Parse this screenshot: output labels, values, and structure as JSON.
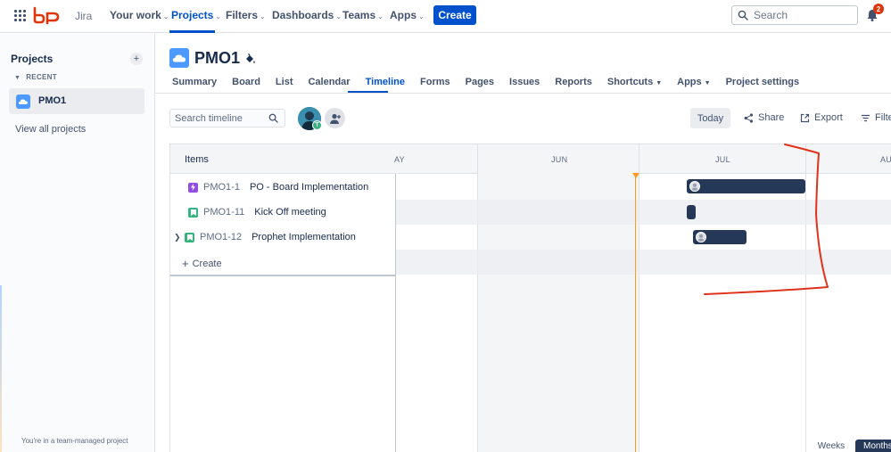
{
  "topnav": {
    "product": "Jira",
    "items": [
      {
        "label": "Your work",
        "chevron": true
      },
      {
        "label": "Projects",
        "chevron": true,
        "active": true
      },
      {
        "label": "Filters",
        "chevron": true
      },
      {
        "label": "Dashboards",
        "chevron": true
      },
      {
        "label": "Teams",
        "chevron": true
      },
      {
        "label": "Apps",
        "chevron": true
      }
    ],
    "create_label": "Create",
    "search_placeholder": "Search",
    "notification_count": "2",
    "icons": {
      "apps": "grid-icon",
      "search": "search-icon",
      "notifications": "bell-icon"
    },
    "accent": "#0052cc"
  },
  "sidebar": {
    "title": "Projects",
    "recent_label": "RECENT",
    "recent_item": "PMO1",
    "view_all": "View all projects",
    "footer": "You're in a team-managed project"
  },
  "project": {
    "name": "PMO1",
    "tabs": [
      {
        "label": "Summary"
      },
      {
        "label": "Board"
      },
      {
        "label": "List"
      },
      {
        "label": "Calendar"
      },
      {
        "label": "Timeline",
        "active": true
      },
      {
        "label": "Forms"
      },
      {
        "label": "Pages"
      },
      {
        "label": "Issues"
      },
      {
        "label": "Reports"
      },
      {
        "label": "Shortcuts",
        "chevron": true
      },
      {
        "label": "Apps",
        "chevron": true
      },
      {
        "label": "Project settings"
      }
    ]
  },
  "toolbar": {
    "search_placeholder": "Search timeline",
    "avatar_badge": "T",
    "today_label": "Today",
    "share_label": "Share",
    "export_label": "Export",
    "filter_label": "Filte"
  },
  "timeline": {
    "items_header": "Items",
    "months": [
      "AY",
      "JUN",
      "JUL",
      "AU"
    ],
    "rows": [
      {
        "key": "PMO1-1",
        "summary": "PO - Board Implementation",
        "type": "epic",
        "type_color": "#904ee2",
        "expandable": false
      },
      {
        "key": "PMO1-11",
        "summary": "Kick Off meeting",
        "type": "story",
        "type_color": "#36b37e",
        "expandable": false
      },
      {
        "key": "PMO1-12",
        "summary": "Prophet Implementation",
        "type": "story",
        "type_color": "#36b37e",
        "expandable": true
      }
    ],
    "create_label": "Create",
    "zoom_weeks": "Weeks",
    "zoom_months": "Months",
    "bar_color": "#253858",
    "today_color": "#ff991f"
  }
}
